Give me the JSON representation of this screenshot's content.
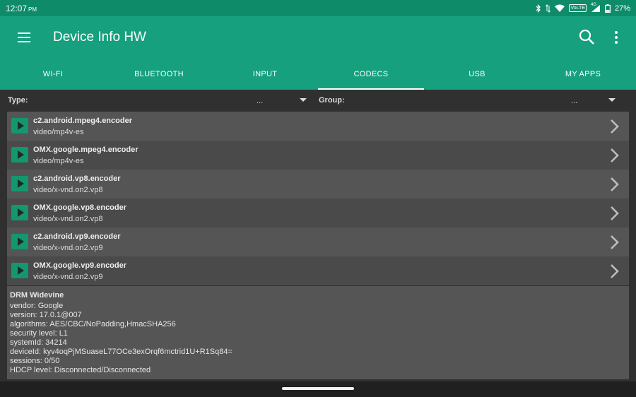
{
  "status_bar": {
    "time": "12:07",
    "ampm": "PM",
    "network_badge": "VoLTE",
    "signal_label": "4G",
    "battery": "27%"
  },
  "app_bar": {
    "title": "Device Info HW",
    "menu_icon": "hamburger-icon",
    "search_icon": "search-icon",
    "more_icon": "more-vert-icon"
  },
  "tabs": [
    {
      "label": "WI-FI"
    },
    {
      "label": "BLUETOOTH"
    },
    {
      "label": "INPUT"
    },
    {
      "label": "CODECS",
      "active": true
    },
    {
      "label": "USB"
    },
    {
      "label": "MY APPS"
    }
  ],
  "filters": {
    "type_label": "Type:",
    "type_value": "...",
    "group_label": "Group:",
    "group_value": "..."
  },
  "codecs": [
    {
      "name": "c2.android.mpeg4.encoder",
      "mime": "video/mp4v-es"
    },
    {
      "name": "OMX.google.mpeg4.encoder",
      "mime": "video/mp4v-es"
    },
    {
      "name": "c2.android.vp8.encoder",
      "mime": "video/x-vnd.on2.vp8"
    },
    {
      "name": "OMX.google.vp8.encoder",
      "mime": "video/x-vnd.on2.vp8"
    },
    {
      "name": "c2.android.vp9.encoder",
      "mime": "video/x-vnd.on2.vp9"
    },
    {
      "name": "OMX.google.vp9.encoder",
      "mime": "video/x-vnd.on2.vp9"
    }
  ],
  "drm": {
    "title": "DRM Widevine",
    "vendor": "vendor: Google",
    "version": "version: 17.0.1@007",
    "algorithms": "algorithms: AES/CBC/NoPadding,HmacSHA256",
    "security_level": "security level: L1",
    "system_id": "systemId: 34214",
    "device_id": "deviceId: kyv4oqPjMSuaseL77OCe3exOrqf6mctrid1U+R1Sq84=",
    "sessions": "sessions: 0/50",
    "hdcp_level": "HDCP level: Disconnected/Disconnected"
  },
  "colors": {
    "primary": "#16a07e",
    "primary_dark": "#0e8c6a",
    "background": "#303030",
    "row_light": "#555555",
    "row_dark": "#4a4a4a"
  }
}
